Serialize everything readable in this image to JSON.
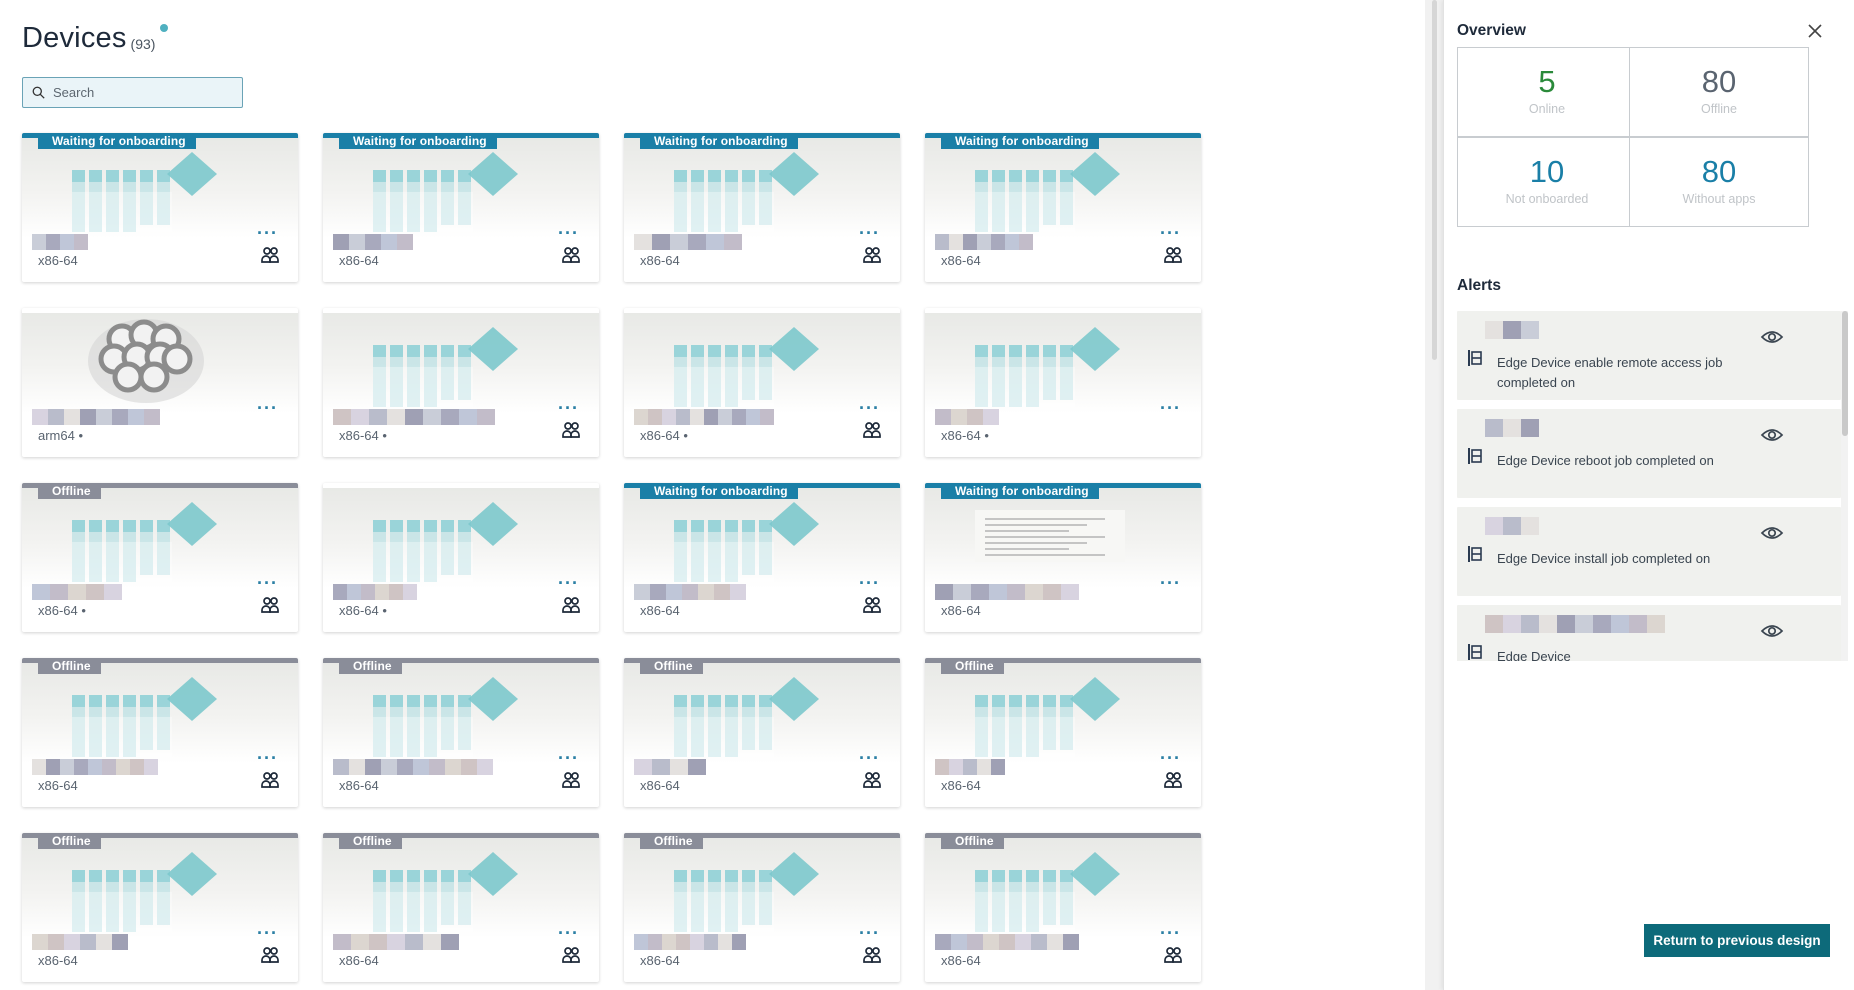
{
  "header": {
    "title": "Devices",
    "count": "(93)"
  },
  "search": {
    "placeholder": "Search"
  },
  "colors": {
    "waiting": "#1a7fa7",
    "offline": "#8a8d99",
    "online": "#2a8a3a",
    "accent": "#1a7fa7"
  },
  "devices": [
    {
      "status": "waiting",
      "badge": "Waiting for onboarding",
      "arch": "x86-64",
      "image": "edge",
      "people": true
    },
    {
      "status": "waiting",
      "badge": "Waiting for onboarding",
      "arch": "x86-64",
      "image": "edge",
      "people": true
    },
    {
      "status": "waiting",
      "badge": "Waiting for onboarding",
      "arch": "x86-64",
      "image": "edge",
      "people": true
    },
    {
      "status": "waiting",
      "badge": "Waiting for onboarding",
      "arch": "x86-64",
      "image": "edge",
      "people": true
    },
    {
      "status": "none",
      "badge": "",
      "arch": "arm64 •",
      "image": "raspberry",
      "people": false
    },
    {
      "status": "none",
      "badge": "",
      "arch": "x86-64 •",
      "image": "edge",
      "people": true
    },
    {
      "status": "none",
      "badge": "",
      "arch": "x86-64 •",
      "image": "edge",
      "people": true
    },
    {
      "status": "none",
      "badge": "",
      "arch": "x86-64 •",
      "image": "edge",
      "people": false
    },
    {
      "status": "offline",
      "badge": "Offline",
      "arch": "x86-64 •",
      "image": "edge",
      "people": true
    },
    {
      "status": "none",
      "badge": "",
      "arch": "x86-64 •",
      "image": "edge",
      "people": true
    },
    {
      "status": "waiting",
      "badge": "Waiting for onboarding",
      "arch": "x86-64",
      "image": "edge",
      "people": true
    },
    {
      "status": "waiting",
      "badge": "Waiting for onboarding",
      "arch": "x86-64",
      "image": "doc",
      "people": false
    },
    {
      "status": "offline",
      "badge": "Offline",
      "arch": "x86-64",
      "image": "edge",
      "people": true
    },
    {
      "status": "offline",
      "badge": "Offline",
      "arch": "x86-64",
      "image": "edge",
      "people": true
    },
    {
      "status": "offline",
      "badge": "Offline",
      "arch": "x86-64",
      "image": "edge",
      "people": true
    },
    {
      "status": "offline",
      "badge": "Offline",
      "arch": "x86-64",
      "image": "edge",
      "people": true
    },
    {
      "status": "offline",
      "badge": "Offline",
      "arch": "x86-64",
      "image": "edge",
      "people": true
    },
    {
      "status": "offline",
      "badge": "Offline",
      "arch": "x86-64",
      "image": "edge",
      "people": true
    },
    {
      "status": "offline",
      "badge": "Offline",
      "arch": "x86-64",
      "image": "edge",
      "people": true
    },
    {
      "status": "offline",
      "badge": "Offline",
      "arch": "x86-64",
      "image": "edge",
      "people": true
    }
  ],
  "panel": {
    "title": "Overview",
    "stats": [
      {
        "value": "5",
        "label": "Online",
        "color": "#2a8a3a"
      },
      {
        "value": "80",
        "label": "Offline",
        "color": "#5a6470"
      },
      {
        "value": "10",
        "label": "Not onboarded",
        "color": "#1a7fa7"
      },
      {
        "value": "80",
        "label": "Without apps",
        "color": "#1a7fa7"
      }
    ],
    "alerts_title": "Alerts",
    "alerts": [
      {
        "message": "Edge Device enable remote access job completed on"
      },
      {
        "message": "Edge Device reboot job completed on"
      },
      {
        "message": "Edge Device install job completed on"
      },
      {
        "message": "Edge Device"
      }
    ],
    "return_button": "Return to previous design"
  }
}
